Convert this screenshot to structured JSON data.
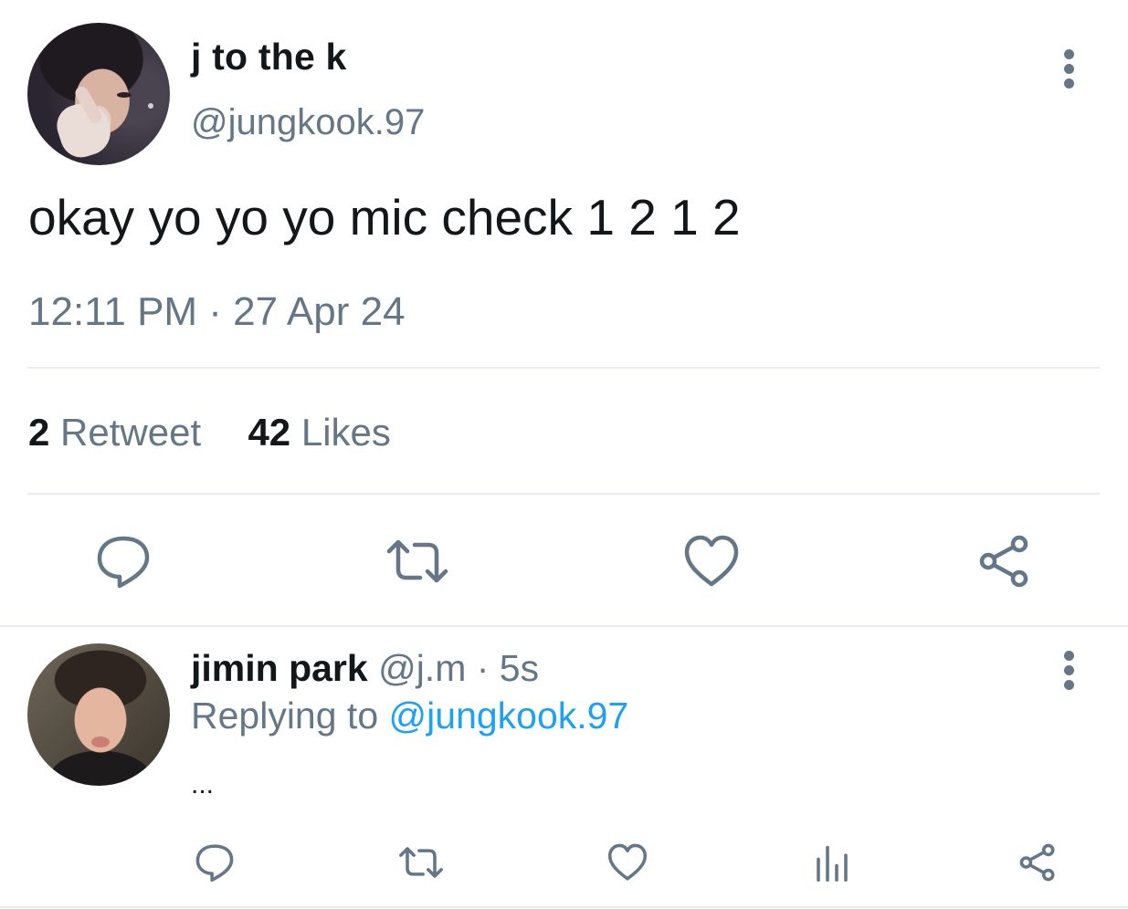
{
  "main_tweet": {
    "display_name": "j to the k",
    "handle": "@jungkook.97",
    "text": "okay yo yo yo mic check 1 2 1 2",
    "timestamp": "12:11 PM · 27 Apr 24",
    "retweet_count": "2",
    "retweet_label": "Retweet",
    "like_count": "42",
    "like_label": "Likes",
    "actions": [
      "reply-icon",
      "retweet-icon",
      "heart-icon",
      "share-icon"
    ]
  },
  "reply_tweet": {
    "display_name": "jimin park",
    "meta": "@j.m · 5s",
    "replying_prefix": "Replying to",
    "replying_handle": "@jungkook.97",
    "text": "...",
    "actions": [
      "reply-icon",
      "retweet-icon",
      "heart-icon",
      "analytics-icon",
      "share-icon"
    ]
  },
  "colors": {
    "text": "#14171a",
    "secondary": "#657786",
    "link": "#1da1f2",
    "divider": "#e6ecf0"
  }
}
